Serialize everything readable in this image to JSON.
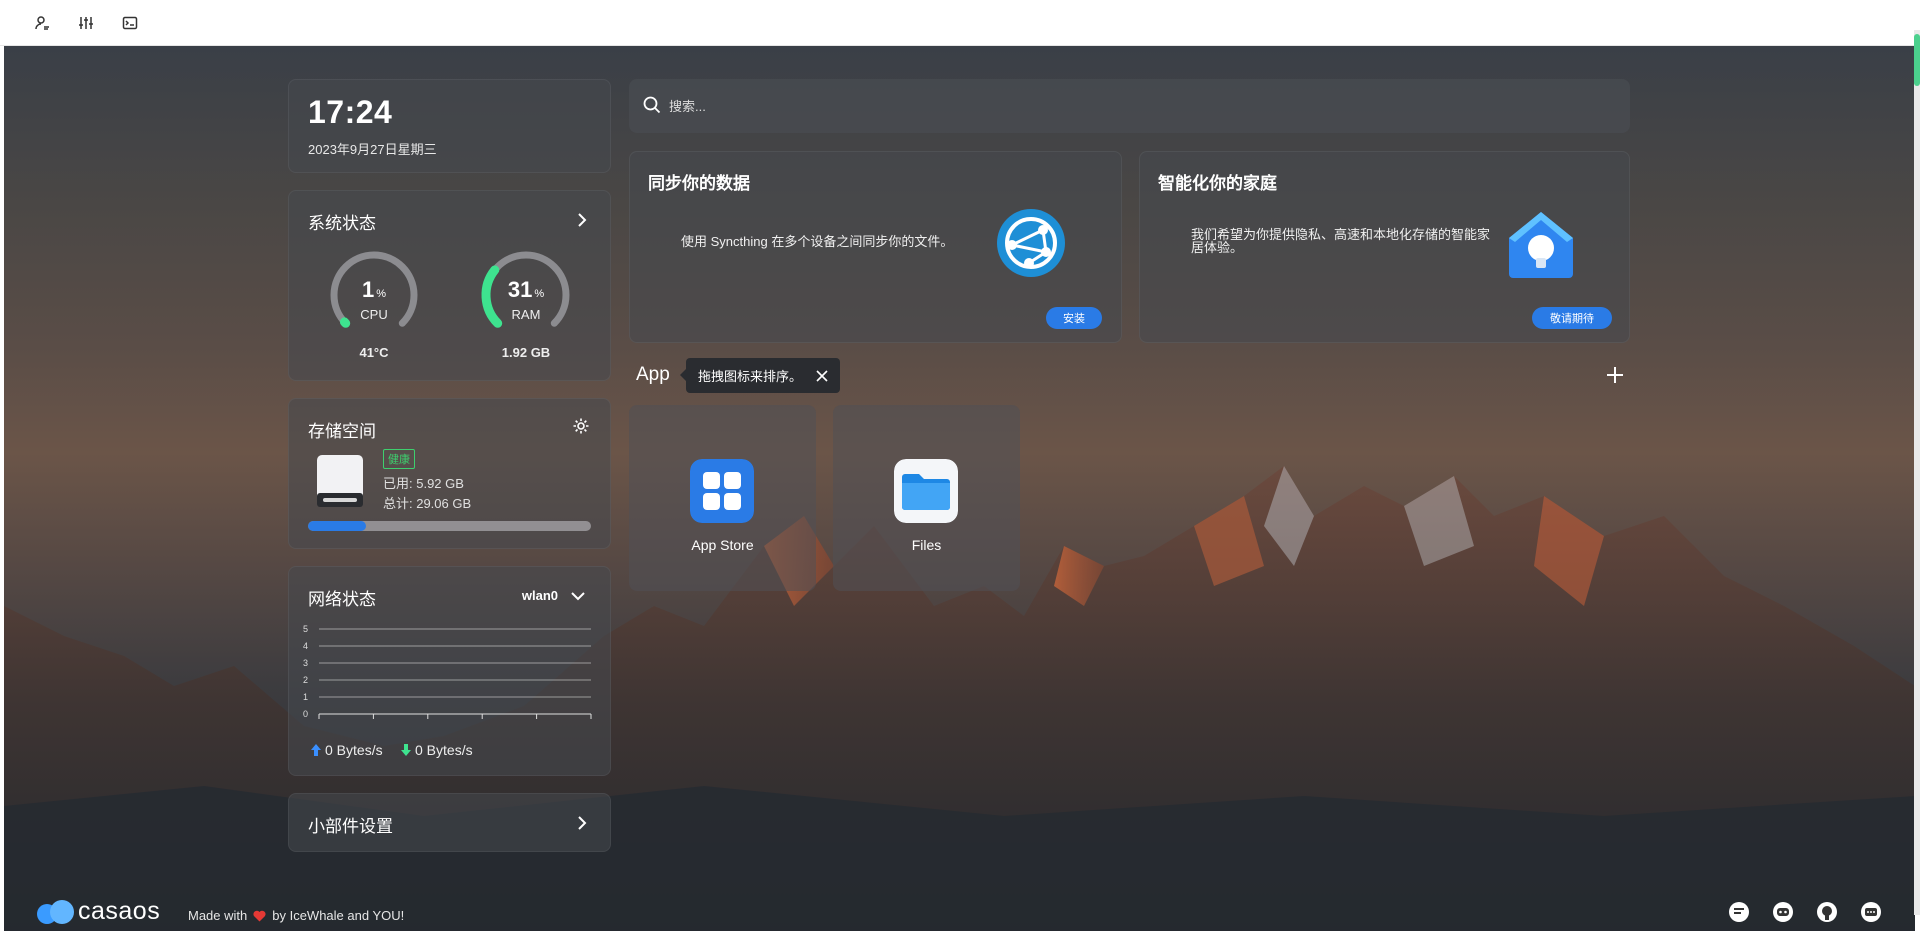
{
  "toolbar": {
    "icons": [
      "user-settings-icon",
      "sliders-icon",
      "terminal-icon"
    ]
  },
  "clock": {
    "time": "17:24",
    "date": "2023年9月27日星期三"
  },
  "system_status": {
    "title": "系统状态",
    "cpu": {
      "value": "1",
      "unit": "%",
      "label": "CPU",
      "sub": "41°C",
      "percent": 1
    },
    "ram": {
      "value": "31",
      "unit": "%",
      "label": "RAM",
      "sub": "1.92 GB",
      "percent": 31
    }
  },
  "storage": {
    "title": "存储空间",
    "health": "健康",
    "used": "已用: 5.92 GB",
    "total": "总计: 29.06 GB",
    "used_fraction": 0.204
  },
  "network": {
    "title": "网络状态",
    "interface": "wlan0",
    "y_ticks": [
      "5",
      "4",
      "3",
      "2",
      "1",
      "0"
    ],
    "upload": "0 Bytes/s",
    "download": "0 Bytes/s"
  },
  "widget_settings": {
    "title": "小部件设置"
  },
  "search": {
    "placeholder": "搜索..."
  },
  "promo_sync": {
    "title": "同步你的数据",
    "description": "使用 Syncthing 在多个设备之间同步你的文件。",
    "button": "安装"
  },
  "promo_home": {
    "title": "智能化你的家庭",
    "description": "我们希望为你提供隐私、高速和本地化存储的智能家居体验。",
    "button": "敬请期待"
  },
  "apps": {
    "section_label": "App",
    "tooltip": "拖拽图标来排序。",
    "items": [
      {
        "name": "App Store"
      },
      {
        "name": "Files"
      }
    ]
  },
  "footer": {
    "brand": "casaos",
    "made_with": "Made with",
    "by": "by IceWhale and YOU!",
    "icons": [
      "forum-icon",
      "discord-icon",
      "github-icon",
      "feedback-icon"
    ]
  },
  "colors": {
    "accent": "#2a7be6",
    "gauge": "#3ee38f",
    "health": "#3ecf6e"
  }
}
